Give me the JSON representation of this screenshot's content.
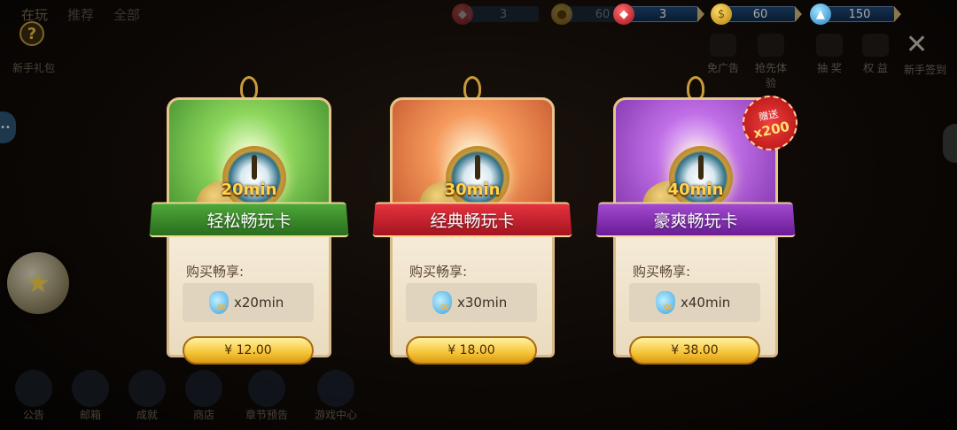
{
  "top_tabs": [
    "在玩",
    "推荐",
    "全部"
  ],
  "resources_dim": [
    {
      "icon": "gem-icon",
      "value": "3"
    },
    {
      "icon": "coin-icon",
      "value": "60"
    }
  ],
  "resources": [
    {
      "icon": "gem-icon",
      "value": "3"
    },
    {
      "icon": "coin-icon",
      "value": "60"
    },
    {
      "icon": "potion-icon",
      "value": "150"
    }
  ],
  "top_left": {
    "help": "?",
    "gift_pack": "新手礼包"
  },
  "features": [
    "免广告",
    "抢先体验",
    "抽 奖",
    "权 益"
  ],
  "close": {
    "label": "新手签到",
    "icon": "✕"
  },
  "bottom_nav": [
    "公告",
    "邮箱",
    "成就",
    "商店",
    "章节预告",
    "游戏中心"
  ],
  "cards": [
    {
      "theme": "green",
      "duration": "20min",
      "title": "轻松畅玩卡",
      "buy_label": "购买畅享:",
      "qty": "x20min",
      "price": "¥ 12.00"
    },
    {
      "theme": "orange",
      "duration": "30min",
      "title": "经典畅玩卡",
      "buy_label": "购买畅享:",
      "qty": "x30min",
      "price": "¥ 18.00"
    },
    {
      "theme": "purple",
      "duration": "40min",
      "title": "豪爽畅玩卡",
      "buy_label": "购买畅享:",
      "qty": "x40min",
      "price": "¥ 38.00"
    }
  ],
  "bonus": {
    "label": "赠送",
    "amount": "x200"
  }
}
